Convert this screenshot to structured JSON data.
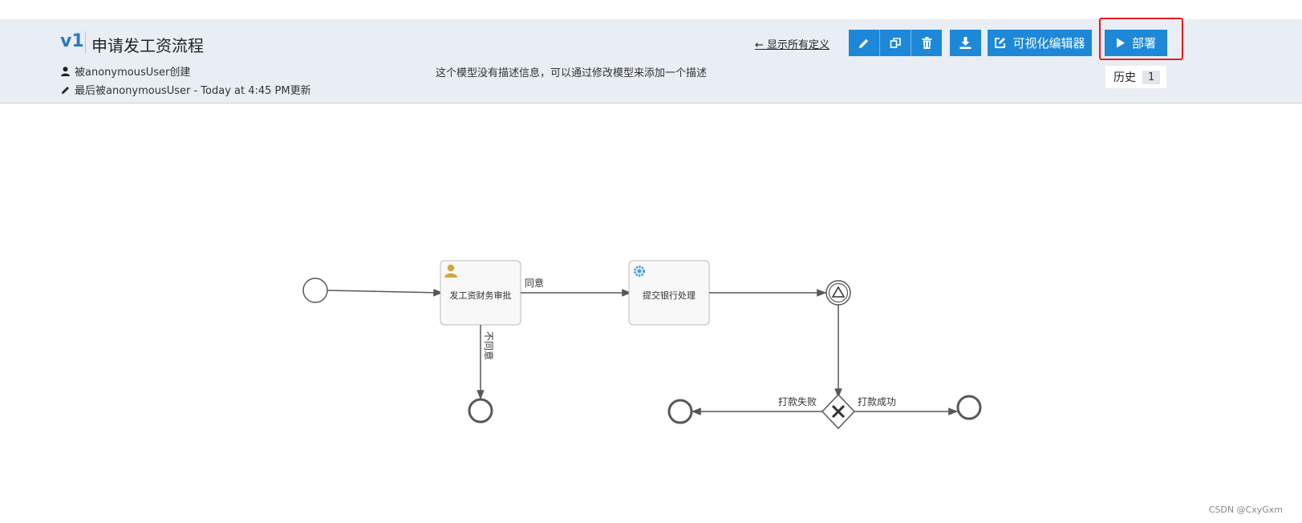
{
  "header": {
    "version": "v1",
    "title": "申请发工资流程",
    "created_by": "被anonymousUser创建",
    "last_updated": "最后被anonymousUser - Today at 4:45 PM更新",
    "description": "这个模型没有描述信息，可以通过修改模型来添加一个描述",
    "show_all_link": "← 显示所有定义"
  },
  "toolbar": {
    "visual_editor_label": "可视化编辑器",
    "deploy_label": "部署",
    "history_label": "历史",
    "history_count": "1"
  },
  "diagram": {
    "task1_label": "发工资财务审批",
    "task2_label": "提交银行处理",
    "flow_agree": "同意",
    "flow_disagree": "不同意",
    "flow_fail": "打款失败",
    "flow_success": "打款成功"
  },
  "icons": [
    "user-icon",
    "pencil-icon",
    "edit-icon",
    "copy-icon",
    "trash-icon",
    "download-icon",
    "external-edit-icon",
    "play-icon",
    "gear-icon",
    "signal-icon",
    "close-x-icon"
  ],
  "colors": {
    "primary": "#1e88d8",
    "highlight": "#e11d1d",
    "header_bg": "#e8eef4"
  },
  "watermark": "CSDN @CxyGxm"
}
